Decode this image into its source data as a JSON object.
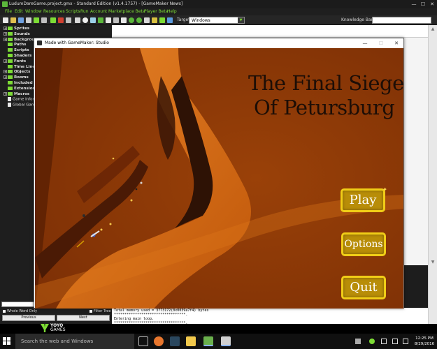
{
  "ide": {
    "title": "LudumDareGame.project.gmx - Standard Edition (v1.4.1757) - [GameMaker News]",
    "menu": [
      "File",
      "Edit",
      "Window",
      "Resources",
      "Scripts",
      "Run",
      "Account",
      "Marketplace Beta",
      "Player Beta",
      "Help"
    ],
    "target_label": "Target:",
    "target_value": "Windows",
    "knowledge_base_label": "Knowledge Base:",
    "resource_tree": [
      {
        "label": "Sprites",
        "kind": "folder",
        "expandable": true
      },
      {
        "label": "Sounds",
        "kind": "folder",
        "expandable": true
      },
      {
        "label": "Backgrounds",
        "kind": "folder",
        "expandable": true
      },
      {
        "label": "Paths",
        "kind": "folder",
        "expandable": false
      },
      {
        "label": "Scripts",
        "kind": "folder",
        "expandable": false
      },
      {
        "label": "Shaders",
        "kind": "folder",
        "expandable": false
      },
      {
        "label": "Fonts",
        "kind": "folder",
        "expandable": true
      },
      {
        "label": "Time Lines",
        "kind": "folder",
        "expandable": false
      },
      {
        "label": "Objects",
        "kind": "folder",
        "expandable": true
      },
      {
        "label": "Rooms",
        "kind": "folder",
        "expandable": true
      },
      {
        "label": "Included Files",
        "kind": "folder",
        "expandable": false
      },
      {
        "label": "Extensions",
        "kind": "folder",
        "expandable": false
      },
      {
        "label": "Macros",
        "kind": "folder",
        "expandable": true
      },
      {
        "label": "Game Information",
        "kind": "doc",
        "expandable": false
      },
      {
        "label": "Global Game Settings",
        "kind": "doc",
        "expandable": false
      }
    ],
    "whole_word_label": "Whole Word Only",
    "filter_tree_label": "Filter Tree",
    "previous_label": "Previous",
    "next_label": "Next",
    "output_lines": [
      "Total memory used = 3773172(0x0039a7f4) bytes",
      "**********************************.",
      "Entering main loop.",
      "**********************************."
    ],
    "logo_line1": "YOYO",
    "logo_line2": "GAMES"
  },
  "game_window": {
    "title": "Made with GameMaker: Studio",
    "controls": {
      "minimize": "—",
      "maximize": "☐",
      "close": "✕"
    },
    "game_title_line1": "The Final Siege",
    "game_title_line2": "Of Petursburg",
    "buttons": {
      "play": "Play",
      "options": "Options",
      "quit": "Quit"
    }
  },
  "taskbar": {
    "search_placeholder": "Search the web and Windows",
    "time": "12:25 PM",
    "date": "8/29/2016"
  },
  "colors": {
    "game_bg": "#8f3a07",
    "road": "#d66a10",
    "button_fill": "#b88d08",
    "button_border": "#f0cd17",
    "ide_accent": "#7ddc35"
  }
}
